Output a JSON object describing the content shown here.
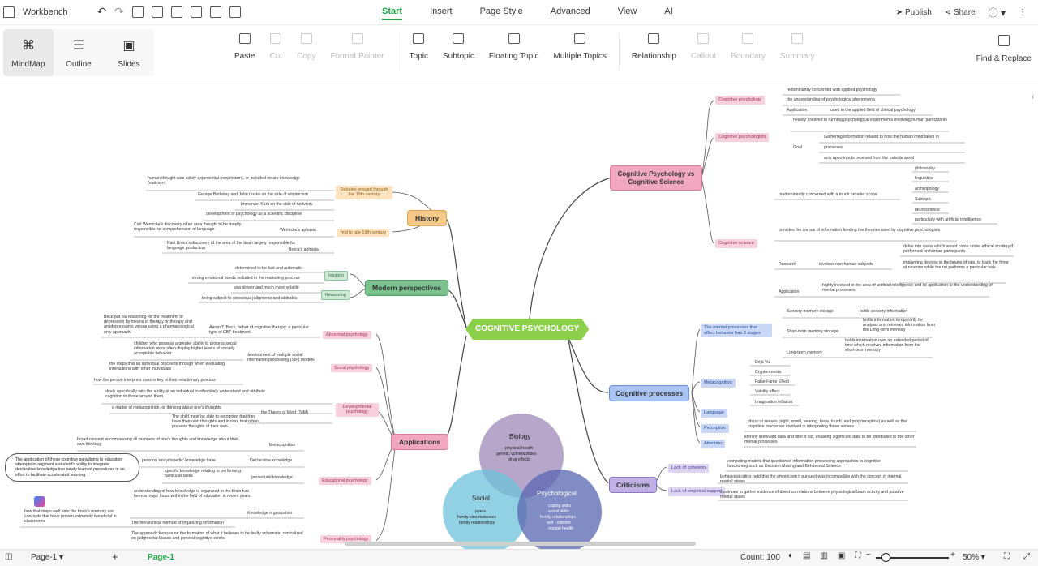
{
  "menubar": {
    "workbench": "Workbench",
    "tabs": [
      "Start",
      "Insert",
      "Page Style",
      "Advanced",
      "View",
      "AI"
    ],
    "publish": "Publish",
    "share": "Share"
  },
  "views": [
    "MindMap",
    "Outline",
    "Slides"
  ],
  "tools": [
    {
      "label": "Paste",
      "enabled": true,
      "icon": "clipboard-icon"
    },
    {
      "label": "Cut",
      "enabled": false,
      "icon": "scissors-icon"
    },
    {
      "label": "Copy",
      "enabled": false,
      "icon": "copy-icon"
    },
    {
      "label": "Format Painter",
      "enabled": false,
      "icon": "brush-icon"
    },
    {
      "label": "Topic",
      "enabled": true,
      "icon": "topic-icon"
    },
    {
      "label": "Subtopic",
      "enabled": true,
      "icon": "subtopic-icon"
    },
    {
      "label": "Floating Topic",
      "enabled": true,
      "icon": "floating-topic-icon"
    },
    {
      "label": "Multiple Topics",
      "enabled": true,
      "icon": "multiple-topics-icon"
    },
    {
      "label": "Relationship",
      "enabled": true,
      "icon": "relationship-icon"
    },
    {
      "label": "Callout",
      "enabled": false,
      "icon": "callout-icon"
    },
    {
      "label": "Boundary",
      "enabled": false,
      "icon": "boundary-icon"
    },
    {
      "label": "Summary",
      "enabled": false,
      "icon": "summary-icon"
    }
  ],
  "find_replace": "Find & Replace",
  "mindmap": {
    "central": "COGNITIVE PSYCHOLOGY",
    "branches": {
      "cog_vs_sci": "Cognitive Psychology vs Cognitive Science",
      "history": "History",
      "modern": "Modern perspectives",
      "applications": "Applications",
      "processes": "Cognitive processes",
      "criticisms": "Criticisms"
    },
    "right_top": {
      "cp": "Cognitive psychology",
      "cp_items": [
        "redominantly concerned with applied psychology",
        "the understanding of psychological phenomena",
        "Application",
        "used in the applied field of clinical psychology"
      ],
      "cps": "Cognitive psychologists",
      "cps_items": [
        "heavily involved in running psychological experiments involving human participants",
        "Goal",
        "Gathering information related to how the human mind takes in",
        "processes",
        "acts upon inputs received from the outside world"
      ],
      "cs": "Cognitive science",
      "cs_items": [
        "predominantly concerned with a much broader scope",
        "philosophy",
        "linguistics",
        "anthropology",
        "Subtopic",
        "neuroscience",
        "particularly with artificial intelligence",
        "provides the corpus of information feeding the theories used by cognitive psychologists",
        "Research",
        "involves non-human subjects",
        "delve into areas which would come under ethical scrutiny if performed on human participants",
        "implanting devices in the brains of rats, to track the firing of neurons while the rat performs a particular task",
        "Application",
        "highly involved in the area of artificial intelligence and its application to the understanding of mental processes"
      ]
    },
    "processes": {
      "stages": "The mental processes that affect behavior has 3 stages",
      "stage_items": [
        "Sensory memory storage",
        "holds sensory information",
        "Short-term memory storage",
        "holds information temporarily for analysis and retrieves information from the Long-term memory",
        "Long-term memory",
        "holds information over an extended period of time which receives information from the short-term memory"
      ],
      "meta": "Metacognition",
      "meta_items": [
        "Déjà Vu",
        "Cryptomnesia",
        "False Fame Effect",
        "Validity effect",
        "Imagination inflation"
      ],
      "language": "Language",
      "perception": "Perception",
      "perception_text": "physical senses (sight, smell, hearing, taste, touch, and proprioception) as well as the cognitive processes involved in interpreting those senses",
      "attention": "Attention",
      "attention_text": "identify irrelevant data and filter it out, enabling significant data to be distributed to the other mental processes"
    },
    "criticisms": {
      "cohesion": "Lack of cohesion",
      "cohesion_text": "competing models that questioned information-processing approaches to cognitive functioning such as Decision Making and Behavioral Science",
      "support": "Lack of empirical support",
      "support_text1": "behavioral critics held that the empiricism it pursued was incompatible with the concept of internal mental states",
      "support_text2": "continues to gather evidence of direct correlations between physiological brain activity and putative mental states"
    },
    "history": {
      "debates": "Debates ensued through the 19th century",
      "debate_items": [
        "human thought was solely experiential (empiricism), or included innate knowledge (nativism)",
        "George Berkeley and John Locke on the side of empiricism",
        "Immanuel Kant on the side of nativism."
      ],
      "mid": "mid to late 19th century",
      "mid_items": [
        "development of psychology as a scientific discipline",
        "Carl Wernicke's discovery of an area thought to be mostly responsible for comprehension of language",
        "Wernicke's aphasia",
        "Paul Broca's discovery of the area of the brain largely responsible for language production",
        "Broca's aphasia"
      ]
    },
    "modern": {
      "intuition": "Intuition",
      "intuition_items": [
        "determined to be fast and automatic",
        "strong emotional bonds included in the reasoning process"
      ],
      "reasoning": "Reasoning",
      "reasoning_items": [
        "was slower and much more volatile",
        "being subject to conscious judgments and attitudes"
      ]
    },
    "applications": {
      "abnormal": "Abnormal psychology",
      "abnormal_items": [
        "Beck put his reasoning for the treatment of depression by means of therapy or therapy and antidepressants versus using a pharmacological only approach.",
        "Aaron T. Beck, father of cognitive therapy, a particular type of CBT treatment."
      ],
      "social": "Social psychology",
      "social_items": [
        "development of multiple social information processing (SIP) models",
        "children who possess a greater ability to process social information more often display higher levels of socially acceptable behavior",
        "the steps that an individual proceeds through when evaluating interactions with other individuals",
        "how the person interprets cues is key to their reactionary process"
      ],
      "developmental": "Developmental psychology",
      "dev_items": [
        "deals specifically with the ability of an individual to effectively understand and attribute cognition to those around them",
        "a matter of metacognition, or thinking about one's thoughts",
        "the Theory of Mind (ToM)",
        "The child must be able to recognize that they have their own thoughts and in turn, that others possess thoughts of their own."
      ],
      "educational": "Educational psychology",
      "edu_items": [
        "broad concept encompassing all manners of one's thoughts and knowledge about their own thinking",
        "Metacognition",
        "persons 'encyclopedic' knowledge base",
        "Declarative knowledge",
        "specific knowledge relating to performing particular tasks",
        "procedural knowledge",
        "understanding of how knowledge is organized in the brain has been a major focus within the field of education in recent years",
        "Knowledge organization",
        "The hierarchical method of organizing information",
        "how that maps well onto the brain's memory are concepts that have proven extremely beneficial in classrooms"
      ],
      "edu_note": "The application of these cognitive paradigms to education attempts to augment a student's ability to integrate declarative knowledge into newly learned procedures in an effort to facilitate accelerated learning.",
      "personality": "Personality psychology",
      "personality_text": "The approach focuses on the formation of what it believes to be faulty schemata, centralized on judgmental biases and general cognitive errors."
    },
    "venn": {
      "biology": "Biology",
      "biology_items": [
        "physical health",
        "genetic vulnerabilities",
        "drug effects"
      ],
      "social": "Social",
      "social_items": [
        "peers",
        "family circumstances",
        "family relationships"
      ],
      "psych": "Psychological",
      "psych_items": [
        "coping skills",
        "social skills",
        "family relationships",
        "self - esteem",
        "mental health"
      ]
    }
  },
  "colors": {
    "central": "#8ccf4a",
    "pink": "#f2a7c0",
    "orange": "#f5c887",
    "green": "#7cc28e",
    "blue": "#a9c4f2",
    "purple": "#c1b0e6"
  },
  "status": {
    "page_tab": "Page-1",
    "page_active": "Page-1",
    "count": "Count: 100",
    "zoom": "50%"
  }
}
